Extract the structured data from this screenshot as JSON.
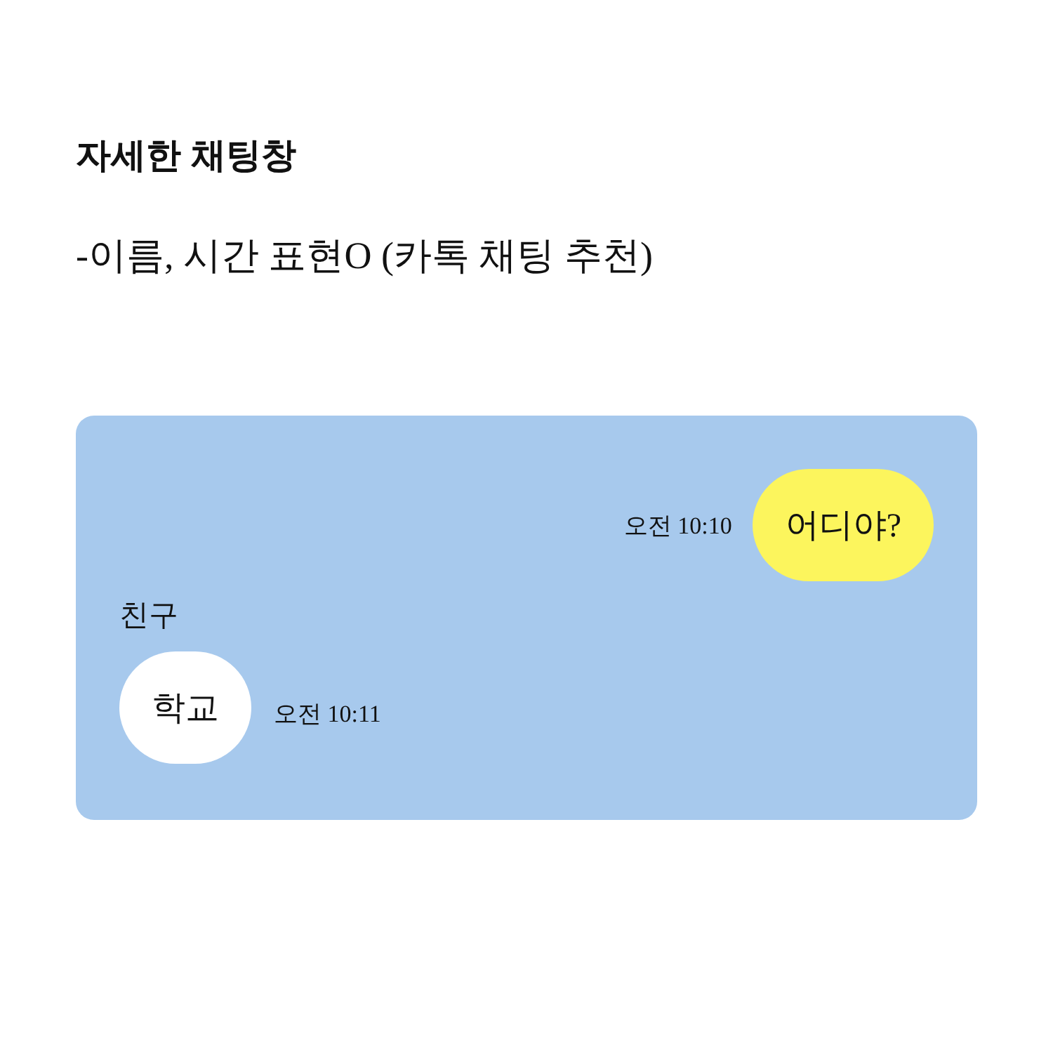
{
  "heading": {
    "title": "자세한 채팅창",
    "subtitle": "-이름, 시간 표현O (카톡 채팅 추천)"
  },
  "chat": {
    "messages": [
      {
        "kind": "sent",
        "text": "어디야?",
        "time": "오전 10:10"
      },
      {
        "kind": "received",
        "sender": "친구",
        "text": "학교",
        "time": "오전 10:11"
      }
    ]
  }
}
